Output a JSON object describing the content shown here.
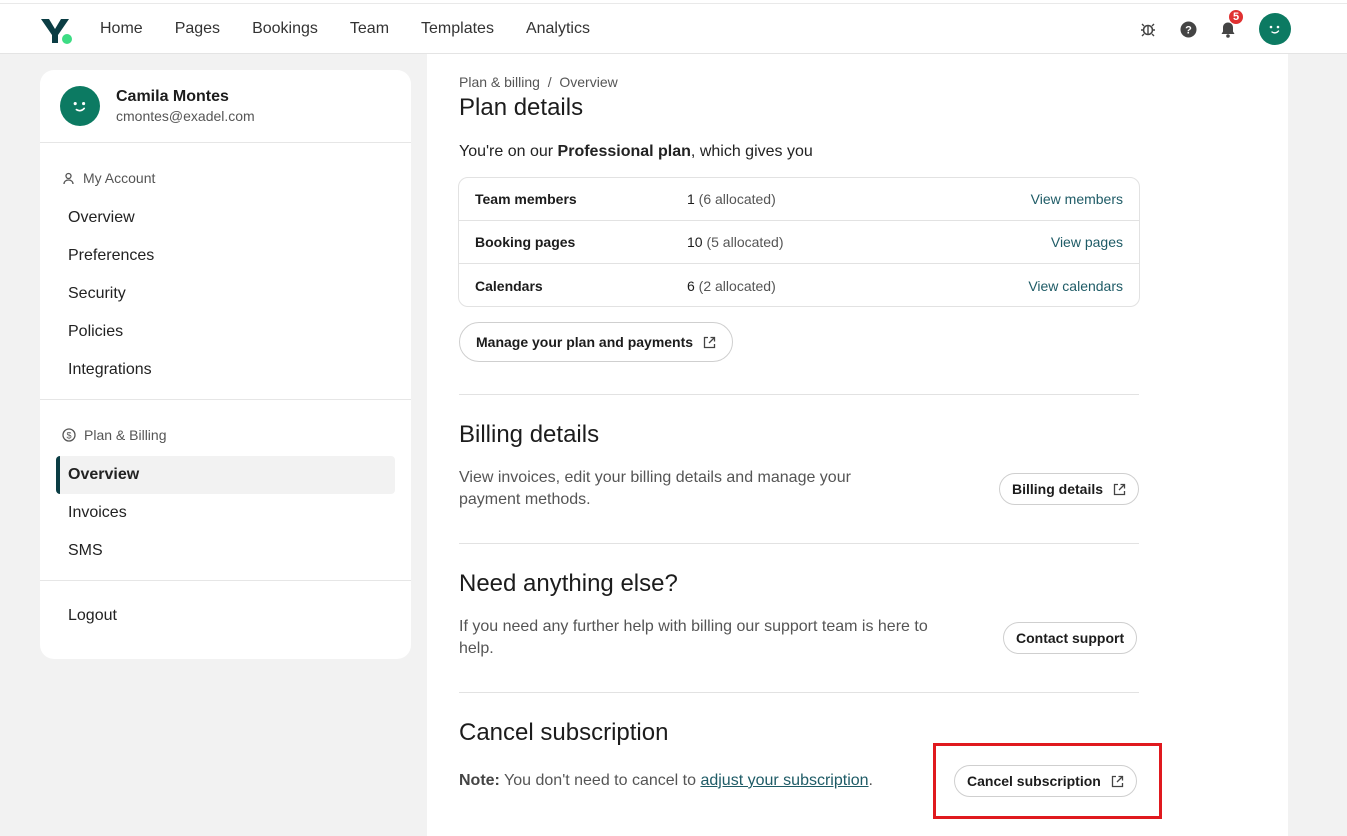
{
  "nav": {
    "items": [
      "Home",
      "Pages",
      "Bookings",
      "Team",
      "Templates",
      "Analytics"
    ],
    "notification_count": "5",
    "icons": [
      "bug-icon",
      "help-icon",
      "bell-icon",
      "avatar"
    ]
  },
  "profile": {
    "name": "Camila Montes",
    "email": "cmontes@exadel.com"
  },
  "sidebar": {
    "account_heading": "My Account",
    "account_items": [
      "Overview",
      "Preferences",
      "Security",
      "Policies",
      "Integrations"
    ],
    "billing_heading": "Plan & Billing",
    "billing_items": [
      "Overview",
      "Invoices",
      "SMS"
    ],
    "active_item": "Overview",
    "logout": "Logout"
  },
  "main": {
    "breadcrumb": "Plan & billing  /  Overview",
    "title": "Plan details",
    "intro_prefix": "You're on our ",
    "intro_plan": "Professional plan",
    "intro_suffix": ", which gives you",
    "plan_rows": [
      {
        "label": "Team members",
        "count": "1",
        "allocated": " (6 allocated)",
        "link": "View members"
      },
      {
        "label": "Booking pages",
        "count": "10",
        "allocated": " (5 allocated)",
        "link": "View pages"
      },
      {
        "label": "Calendars",
        "count": "6",
        "allocated": " (2 allocated)",
        "link": "View calendars"
      }
    ],
    "manage_button": "Manage your plan and payments",
    "billing": {
      "title": "Billing details",
      "text": "View invoices, edit your billing details and manage your payment methods.",
      "button": "Billing details"
    },
    "support": {
      "title": "Need anything else?",
      "text": "If you need any further help with billing our support team is here to help.",
      "button": "Contact support"
    },
    "cancel": {
      "title": "Cancel subscription",
      "note_label": "Note:",
      "note_text": " You don't need to cancel to ",
      "note_link": "adjust your subscription",
      "note_end": ".",
      "button": "Cancel subscription"
    }
  },
  "colors": {
    "accent": "#0c7a62",
    "link": "#1e5b66",
    "badge": "#e03131",
    "highlight": "#e0191e"
  }
}
